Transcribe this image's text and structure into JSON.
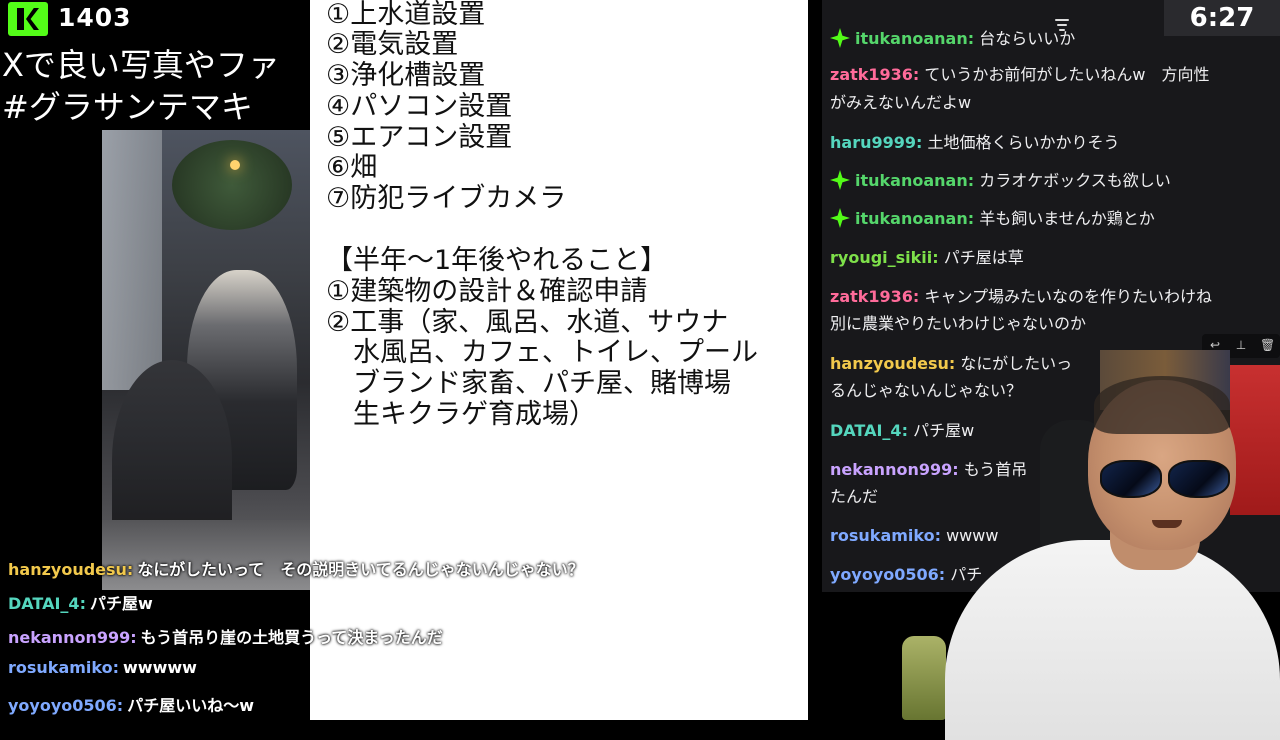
{
  "stream": {
    "viewer_count": "1403",
    "title_line1": "Xで良い写真やファ",
    "title_line2": "#グラサンテマキ",
    "timer": "6:27"
  },
  "left_chat": [
    {
      "user": "hanzyoudesu:",
      "message": "なにがしたいって　その説明きいてるんじゃないんじゃない？",
      "color": "#f2c94c"
    },
    {
      "user": "DATAI_4:",
      "message": "パチ屋w",
      "color": "#55d6be"
    },
    {
      "user": "nekannon999:",
      "message": "もう首吊り崖の土地買うって決まったんだ",
      "color": "#c9a3ff"
    },
    {
      "user": "rosukamiko:",
      "message": "wwwww",
      "color": "#7fa9ff"
    },
    {
      "user": "yoyoyo0506:",
      "message": "パチ屋いいね〜w",
      "color": "#7fa9ff"
    }
  ],
  "document": {
    "lines": [
      "①上水道設置",
      "②電気設置",
      "③浄化槽設置",
      "④パソコン設置",
      "⑤エアコン設置",
      "⑥畑",
      "⑦防犯ライブカメラ",
      "",
      "【半年～1年後やれること】",
      "①建築物の設計＆確認申請",
      "②工事（家、風呂、水道、サウナ",
      "　水風呂、カフェ、トイレ、プール",
      "　ブランド家畜、パチ屋、賭博場",
      "　生キクラゲ育成場）"
    ]
  },
  "right_chat": [
    {
      "user": "itukanoanan:",
      "message": "台ならいいか",
      "color": "#55d66b",
      "badge": true
    },
    {
      "user": "zatk1936:",
      "message": "ていうかお前何がしたいねんw　方向性",
      "color": "#ff6b9a",
      "badge": false
    },
    {
      "user": "",
      "message": "がみえないんだよw",
      "color": "#ff6b9a",
      "badge": false
    },
    {
      "user": "haru9999:",
      "message": "土地価格くらいかかりそう",
      "color": "#55d6be",
      "badge": false
    },
    {
      "user": "itukanoanan:",
      "message": "カラオケボックスも欲しい",
      "color": "#55d66b",
      "badge": true
    },
    {
      "user": "itukanoanan:",
      "message": "羊も飼いませんか鶏とか",
      "color": "#55d66b",
      "badge": true
    },
    {
      "user": "ryougi_sikii:",
      "message": "パチ屋は草",
      "color": "#7ee04a",
      "badge": false
    },
    {
      "user": "zatk1936:",
      "message": "キャンプ場みたいなのを作りたいわけね",
      "color": "#ff6b9a",
      "badge": false
    },
    {
      "user": "",
      "message": "別に農業やりたいわけじゃないのか",
      "color": "#ff6b9a",
      "badge": false
    },
    {
      "user": "hanzyoudesu:",
      "message": "なにがしたいっ",
      "color": "#f2c94c",
      "badge": false
    },
    {
      "user": "",
      "message": "るんじゃないんじゃない？",
      "color": "#f2c94c",
      "badge": false
    },
    {
      "user": "DATAI_4:",
      "message": "パチ屋w",
      "color": "#55d6be",
      "badge": false
    },
    {
      "user": "nekannon999:",
      "message": "もう首吊",
      "color": "#c9a3ff",
      "badge": false
    },
    {
      "user": "",
      "message": "たんだ",
      "color": "#c9a3ff",
      "badge": false
    },
    {
      "user": "rosukamiko:",
      "message": "wwww",
      "color": "#7fa9ff",
      "badge": false
    },
    {
      "user": "yoyoyo0506:",
      "message": "パチ",
      "color": "#7fa9ff",
      "badge": false
    }
  ],
  "icons": {
    "logo": "kick-logo-icon",
    "badge": "sparkle-badge-icon",
    "scroll": "scroll-menu-icon",
    "reply": "reply-icon",
    "pin": "pin-icon",
    "delete": "trash-icon"
  },
  "colors": {
    "brand_green": "#53fc18",
    "chat_bg": "#18181b",
    "doc_bg": "#ffffff"
  }
}
